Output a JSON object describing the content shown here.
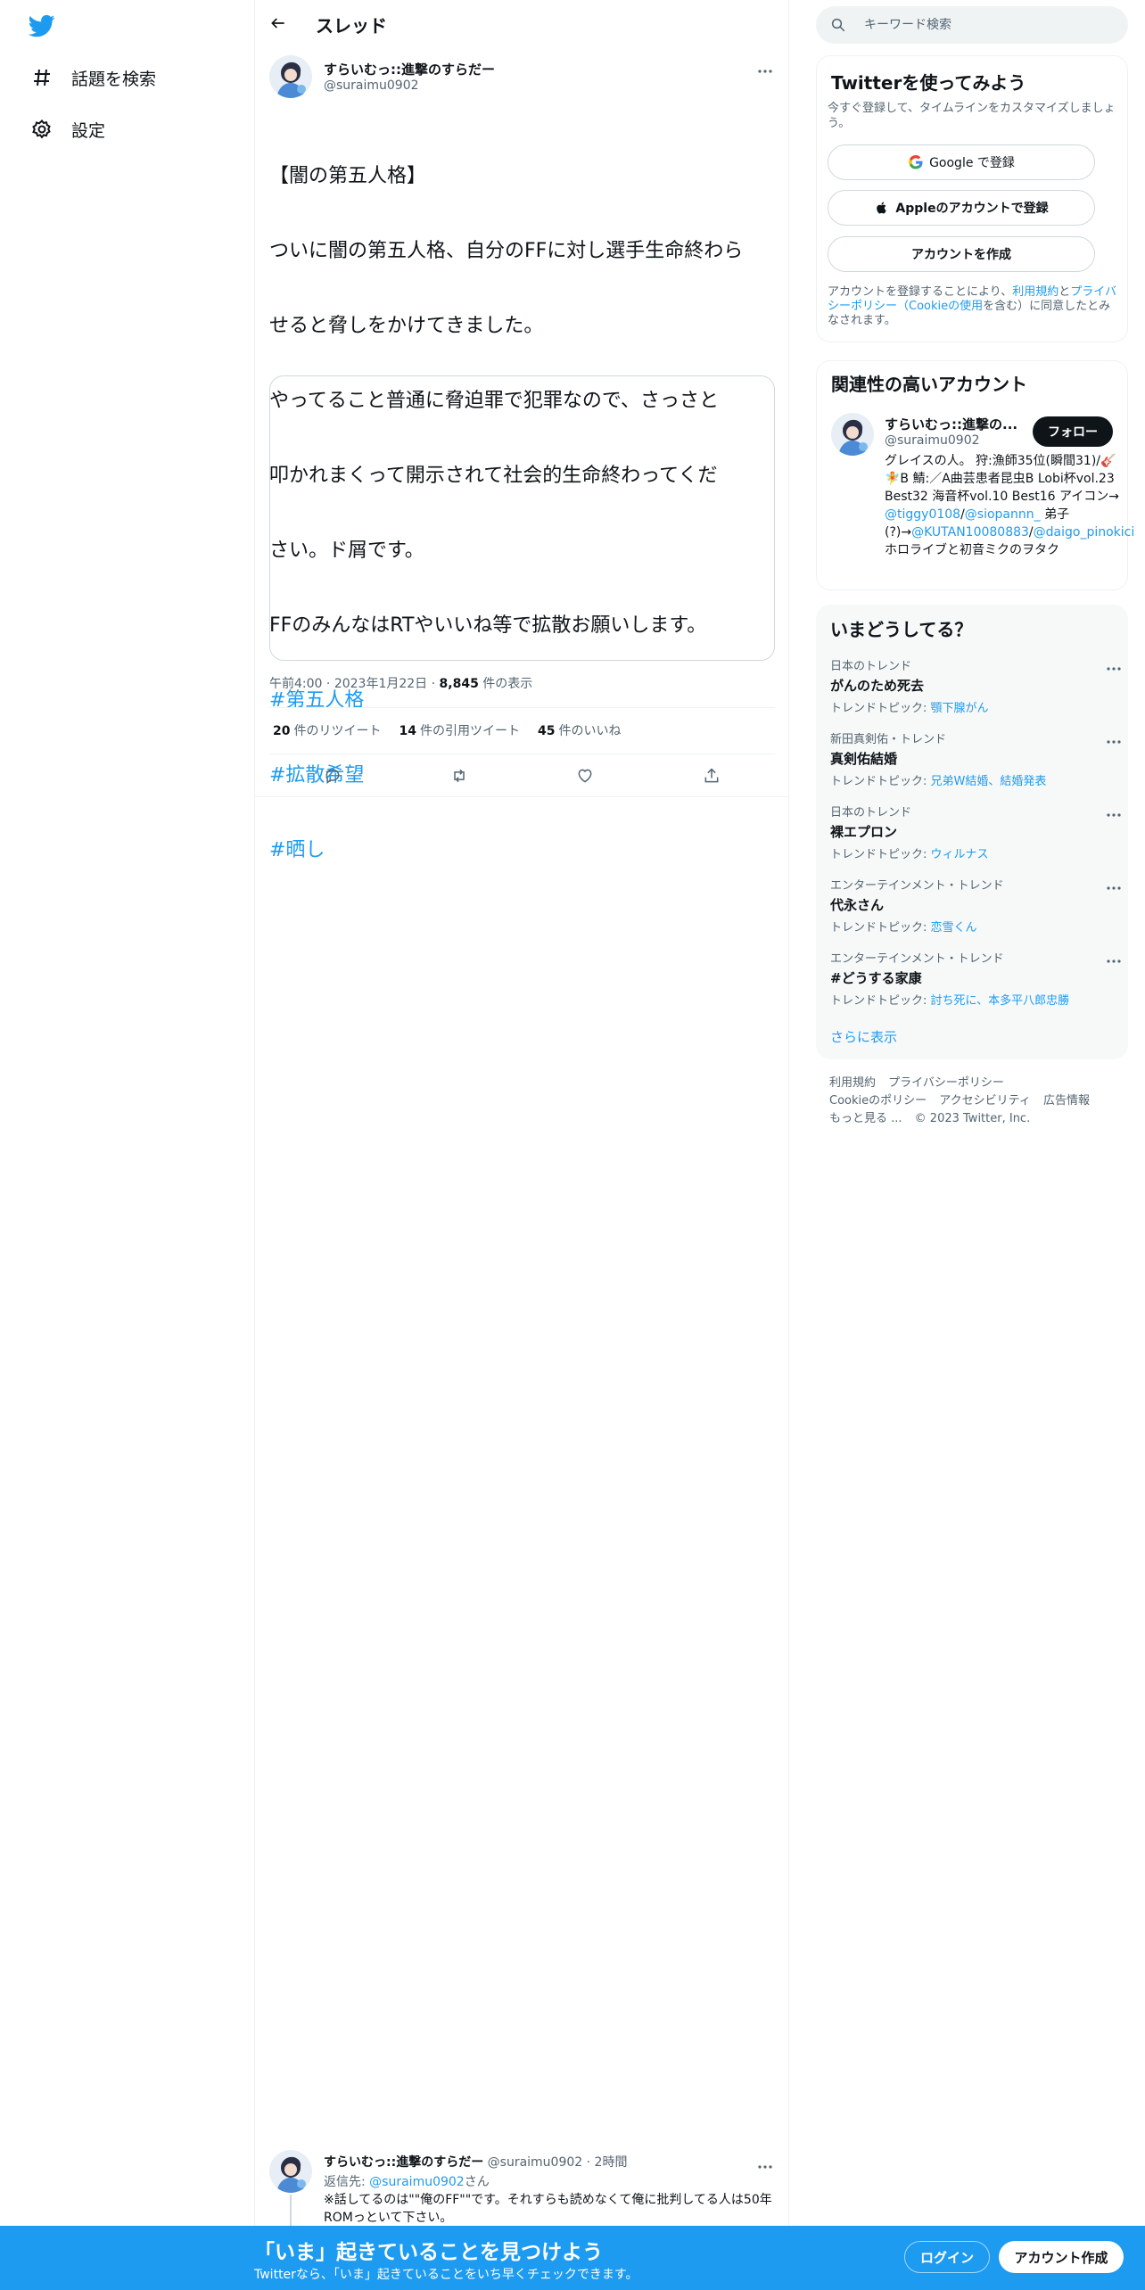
{
  "nav": {
    "explore_label": "話題を検索",
    "settings_label": "設定"
  },
  "thread": {
    "title": "スレッド"
  },
  "tweet": {
    "author_name": "すらいむっ::進撃のすらだー",
    "author_handle": "@suraimu0902",
    "lines": [
      "【闇の第五人格】",
      "ついに闇の第五人格、自分のFFに対し選手生命終わら",
      "せると脅しをかけてきました。",
      "やってること普通に脅迫罪で犯罪なので、さっさと",
      "叩かれまくって開示されて社会的生命終わってくだ",
      "さい。ド屑です。",
      "FFのみんなはRTやいいね等で拡散お願いします。"
    ],
    "hashtags": [
      "#第五人格",
      "#拡散希望",
      "#晒し"
    ],
    "time": "午前4:00",
    "date": "2023年1月22日",
    "views_count": "8,845",
    "views_label": "件の表示",
    "retweets_count": "20",
    "retweets_label": "件のリツイート",
    "quotes_count": "14",
    "quotes_label": "件の引用ツイート",
    "likes_count": "45",
    "likes_label": "件のいいね"
  },
  "reply": {
    "author_name": "すらいむっ::進撃のすらだー",
    "author_handle": "@suraimu0902",
    "time_ago": "2時間",
    "reply_prefix": "返信先: ",
    "reply_handle": "@suraimu0902",
    "reply_suffix": "さん",
    "text": "※話してるのは\"\"俺のFF\"\"です。それすらも読めなくて俺に批判してる人は50年ROMっといて下さい。"
  },
  "search": {
    "placeholder": "キーワード検索"
  },
  "signup_panel": {
    "title": "Twitterを使ってみよう",
    "desc": "今すぐ登録して、タイムラインをカスタマイズしましょう。",
    "google_label": "Google で登録",
    "apple_label": "Appleのアカウントで登録",
    "create_label": "アカウントを作成",
    "terms_prefix": "アカウントを登録することにより、",
    "terms_link1": "利用規約",
    "terms_and": "と",
    "terms_link2": "プライバシーポリシー（Cookieの使用",
    "terms_suffix": "を含む）に同意したとみなされます。"
  },
  "relevant": {
    "title": "関連性の高いアカウント",
    "name": "すらいむっ::進撃の...",
    "handle": "@suraimu0902",
    "follow_label": "フォロー",
    "bio_1": "グレイスの人。 狩:漁師35位(瞬間31)/🎸🧚B 鯖:／A曲芸患者昆虫B Lobi杯vol.23 Best32 海音杯vol.10 Best16 アイコン→ ",
    "bio_mention1": "@tiggy0108",
    "bio_slash": "/",
    "bio_mention2": "@siopannn_",
    "bio_2": " 弟子(?)→",
    "bio_mention3": "@KUTAN10080883",
    "bio_slash2": "/",
    "bio_mention4": "@daigo_pinokici",
    "bio_3": " ホロライブと初音ミクのヲタク"
  },
  "trends": {
    "title": "いまどうしてる？",
    "items": [
      {
        "category": "日本のトレンド",
        "name": "がんのため死去",
        "topic_label": "トレンドトピック: ",
        "topic": "顎下腺がん"
      },
      {
        "category": "新田真剣佑・トレンド",
        "name": "真剣佑結婚",
        "topic_label": "トレンドトピック: ",
        "topic": "兄弟W結婚、結婚発表"
      },
      {
        "category": "日本のトレンド",
        "name": "裸エプロン",
        "topic_label": "トレンドトピック: ",
        "topic": "ウィルナス"
      },
      {
        "category": "エンターテインメント・トレンド",
        "name": "代永さん",
        "topic_label": "トレンドトピック: ",
        "topic": "恋雪くん"
      },
      {
        "category": "エンターテインメント・トレンド",
        "name": "#どうする家康",
        "topic_label": "トレンドトピック: ",
        "topic": "討ち死に、本多平八郎忠勝"
      }
    ],
    "show_more": "さらに表示"
  },
  "footer": {
    "terms": "利用規約",
    "privacy": "プライバシーポリシー",
    "cookie": "Cookieのポリシー",
    "accessibility": "アクセシビリティ",
    "ads": "広告情報",
    "more": "もっと見る ...",
    "copyright": "© 2023 Twitter, Inc."
  },
  "bottom_bar": {
    "title": "「いま」起きていることを見つけよう",
    "subtitle": "Twitterなら、「いま」起きていることをいち早くチェックできます。",
    "login_label": "ログイン",
    "signup_label": "アカウント作成"
  },
  "colors": {
    "brand": "#1d9bf0",
    "text": "#0f1419",
    "muted": "#536471"
  }
}
